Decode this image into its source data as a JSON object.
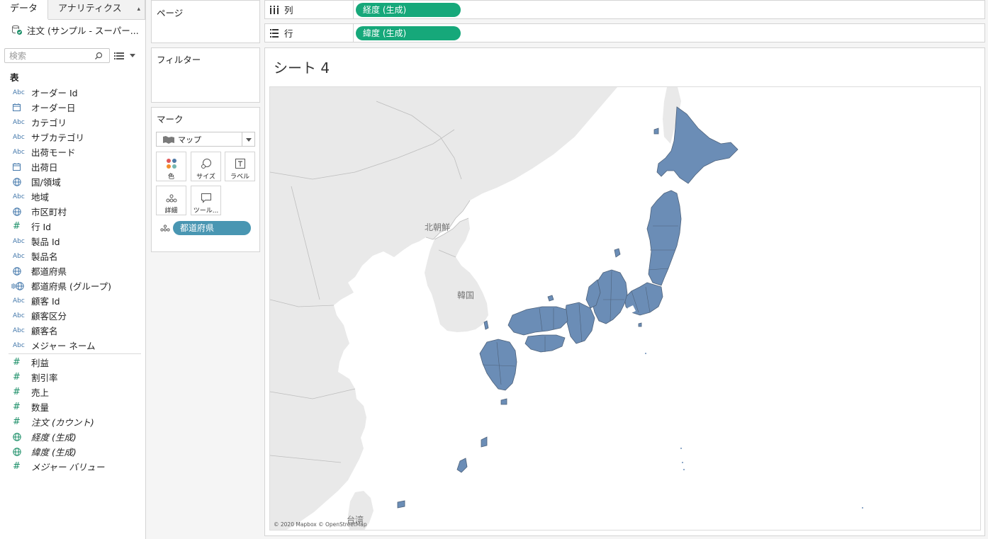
{
  "datapane": {
    "tab_data": "データ",
    "tab_analytics": "アナリティクス",
    "datasource": "注文 (サンプル - スーパー...",
    "search_placeholder": "検索",
    "table_header": "表",
    "fields": [
      {
        "type": "Abc",
        "name": "オーダー Id"
      },
      {
        "type": "date",
        "name": "オーダー日"
      },
      {
        "type": "Abc",
        "name": "カテゴリ"
      },
      {
        "type": "Abc",
        "name": "サブカテゴリ"
      },
      {
        "type": "Abc",
        "name": "出荷モード"
      },
      {
        "type": "date",
        "name": "出荷日"
      },
      {
        "type": "geo",
        "name": "国/領域"
      },
      {
        "type": "Abc",
        "name": "地域"
      },
      {
        "type": "geo",
        "name": "市区町村"
      },
      {
        "type": "#",
        "name": "行 Id"
      },
      {
        "type": "Abc",
        "name": "製品 Id"
      },
      {
        "type": "Abc",
        "name": "製品名"
      },
      {
        "type": "geo",
        "name": "都道府県"
      },
      {
        "type": "geogroup",
        "name": "都道府県 (グループ)"
      },
      {
        "type": "Abc",
        "name": "顧客 Id"
      },
      {
        "type": "Abc",
        "name": "顧客区分"
      },
      {
        "type": "Abc",
        "name": "顧客名"
      },
      {
        "type": "Abc",
        "name": "メジャー ネーム"
      }
    ],
    "measures": [
      {
        "type": "#",
        "name": "利益"
      },
      {
        "type": "#",
        "name": "割引率"
      },
      {
        "type": "#",
        "name": "売上"
      },
      {
        "type": "#",
        "name": "数量"
      },
      {
        "type": "#",
        "name": "注文 (カウント)",
        "italic": true
      },
      {
        "type": "geo",
        "name": "経度 (生成)",
        "italic": true
      },
      {
        "type": "geo",
        "name": "緯度 (生成)",
        "italic": true
      },
      {
        "type": "#",
        "name": "メジャー バリュー",
        "italic": true
      }
    ]
  },
  "pages": {
    "title": "ページ"
  },
  "filters": {
    "title": "フィルター"
  },
  "marks": {
    "title": "マーク",
    "type": "マップ",
    "buttons": {
      "color": "色",
      "size": "サイズ",
      "label": "ラベル",
      "detail": "詳細",
      "tooltip": "ツール..."
    },
    "detail_pill": "都道府県"
  },
  "columns": {
    "label": "列",
    "pill": "経度 (生成)"
  },
  "rows": {
    "label": "行",
    "pill": "緯度 (生成)"
  },
  "sheet": {
    "title": "シート 4"
  },
  "map": {
    "labels": {
      "north_korea": "北朝鮮",
      "south_korea": "韓国",
      "taiwan": "台湾"
    },
    "attribution": "© 2020 Mapbox © OpenStreetMap",
    "fill_color": "#6b8db6",
    "border_color": "#4e627b"
  },
  "colors": {
    "green_pill": "#16a87a",
    "blue_pill": "#4996b2",
    "dimension_icon": "#4478ab",
    "measure_icon": "#1c8f68"
  }
}
